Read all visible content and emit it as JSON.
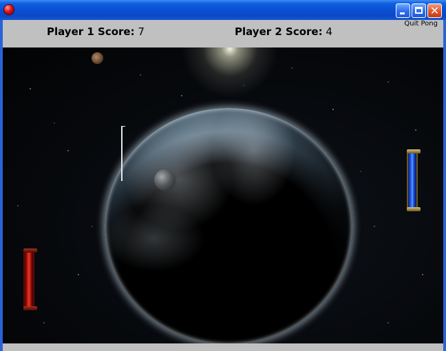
{
  "window": {
    "buttons": [
      "minimize",
      "maximize",
      "close"
    ],
    "close_glyph": "✕"
  },
  "scoreboard": {
    "player1": {
      "label": "Player 1 Score:",
      "value": "7"
    },
    "player2": {
      "label": "Player 2 Score:",
      "value": "4"
    },
    "quit_label": "Quit Pong"
  },
  "game": {
    "paddles": [
      {
        "player": 1,
        "color": "#c41a10"
      },
      {
        "player": 2,
        "color": "#2a5ef0"
      }
    ],
    "ball_color": "#6b4a30"
  },
  "colors": {
    "titlebar": "#0a4fd4",
    "scorebar": "#c0c0c0"
  }
}
